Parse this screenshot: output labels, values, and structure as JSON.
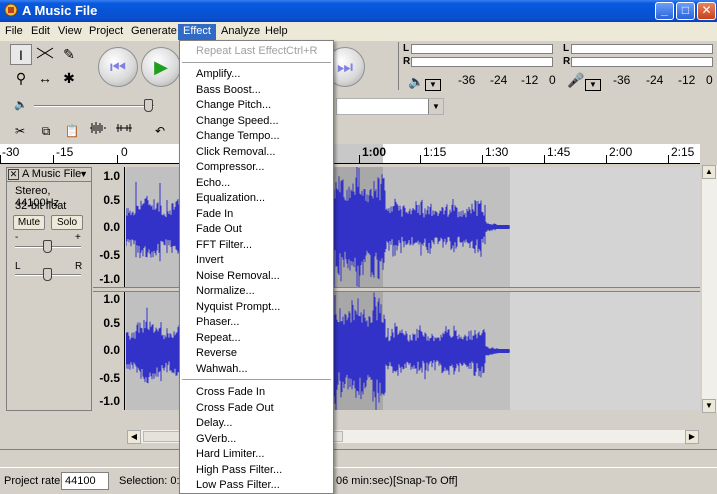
{
  "window": {
    "title": "A Music File",
    "minimize": "_",
    "maximize": "□",
    "close": "✕"
  },
  "menubar": [
    "File",
    "Edit",
    "View",
    "Project",
    "Generate",
    "Effect",
    "Analyze",
    "Help"
  ],
  "transport": {
    "rewind": "⏮",
    "play": "▶",
    "forward": "⏭"
  },
  "meters": {
    "output_label_l": "L",
    "output_label_r": "R",
    "input_label_l": "L",
    "input_label_r": "R",
    "output_scale": [
      "-36",
      "-24",
      "-12",
      "0"
    ],
    "input_scale": [
      "-36",
      "-24",
      "-12",
      "0"
    ]
  },
  "ruler": [
    "-30",
    "-15",
    "0",
    "1:00",
    "1:15",
    "1:30",
    "1:45",
    "2:00",
    "2:15"
  ],
  "track": {
    "name": "A Music File",
    "rate_info": "Stereo, 44100Hz",
    "format_info": "32-bit float",
    "mute": "Mute",
    "solo": "Solo",
    "gain_minus": "-",
    "gain_plus": "+",
    "pan_left": "L",
    "pan_right": "R",
    "scale_top": [
      "1.0",
      "0.5",
      "0.0",
      "-0.5",
      "-1.0"
    ],
    "scale_bottom": [
      "1.0",
      "0.5",
      "0.0",
      "-0.5",
      "-1.0"
    ]
  },
  "status": {
    "project_rate_label": "Project rate:",
    "project_rate_value": "44100",
    "selection_prefix": "Selection: 0:4",
    "selection_suffix": "06 min:sec)",
    "snap": "[Snap-To Off]"
  },
  "effect_menu": {
    "repeat_last": "Repeat Last Effect",
    "repeat_shortcut": "Ctrl+R",
    "group1": [
      "Amplify...",
      "Bass Boost...",
      "Change Pitch...",
      "Change Speed...",
      "Change Tempo...",
      "Click Removal...",
      "Compressor...",
      "Echo...",
      "Equalization...",
      "Fade In",
      "Fade Out",
      "FFT Filter...",
      "Invert",
      "Noise Removal...",
      "Normalize...",
      "Nyquist Prompt...",
      "Phaser...",
      "Repeat...",
      "Reverse",
      "Wahwah..."
    ],
    "group2": [
      "Cross Fade In",
      "Cross Fade Out",
      "Delay...",
      "GVerb...",
      "Hard Limiter...",
      "High Pass Filter...",
      "Low Pass Filter..."
    ]
  },
  "colors": {
    "title_bar": "#0654d6",
    "menu_highlight": "#316ac5",
    "waveform": "#3232c8",
    "track_bg": "#c0c0c0",
    "selection_bg": "#a8a8a8"
  }
}
